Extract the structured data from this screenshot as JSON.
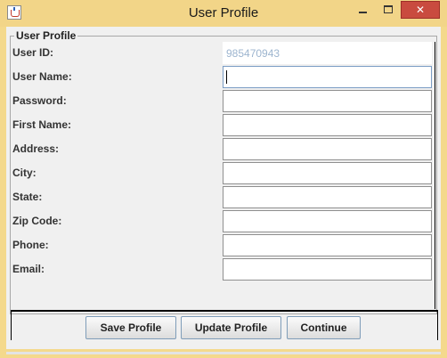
{
  "window": {
    "title": "User Profile",
    "close_glyph": "✕",
    "colors": {
      "frame": "#f4d98c",
      "close": "#c94b3f"
    }
  },
  "group": {
    "title": "User Profile"
  },
  "fields": [
    {
      "label": "User ID:",
      "value": "985470943",
      "readonly": true
    },
    {
      "label": "User Name:",
      "value": "",
      "focused": true
    },
    {
      "label": "Password:",
      "value": ""
    },
    {
      "label": "First Name:",
      "value": ""
    },
    {
      "label": "Address:",
      "value": ""
    },
    {
      "label": "City:",
      "value": ""
    },
    {
      "label": "State:",
      "value": ""
    },
    {
      "label": "Zip Code:",
      "value": ""
    },
    {
      "label": "Phone:",
      "value": ""
    },
    {
      "label": "Email:",
      "value": ""
    }
  ],
  "buttons": {
    "save": "Save Profile",
    "update": "Update Profile",
    "continue": "Continue"
  },
  "icons": [
    "java-cup-icon",
    "minimize-icon",
    "maximize-icon",
    "close-icon"
  ]
}
